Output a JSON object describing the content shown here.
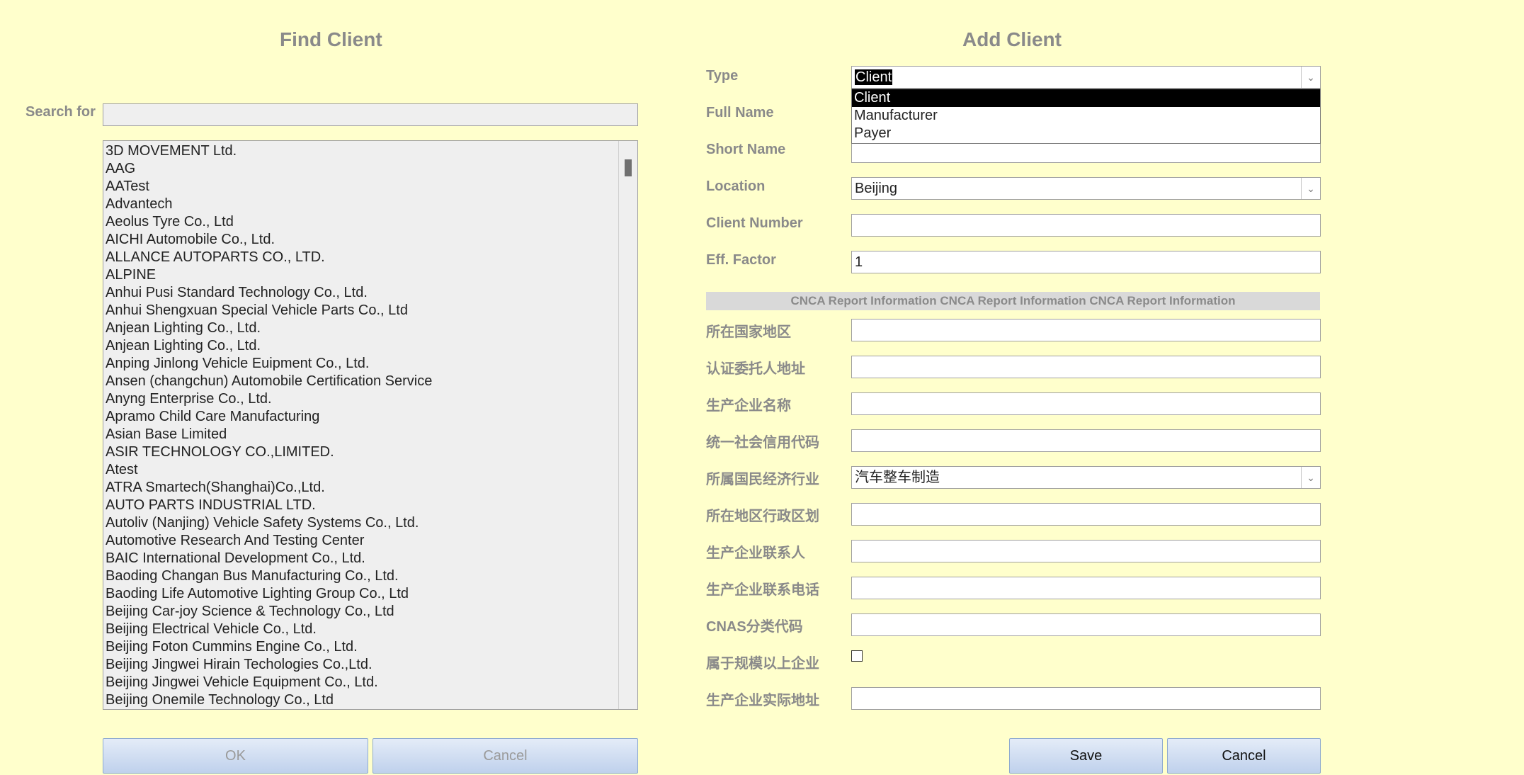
{
  "find": {
    "title": "Find Client",
    "search_label": "Search for",
    "search_value": "",
    "clients": [
      "3D MOVEMENT Ltd.",
      "AAG",
      "AATest",
      "Advantech",
      "Aeolus Tyre Co., Ltd",
      "AICHI Automobile Co., Ltd.",
      "ALLANCE AUTOPARTS CO., LTD.",
      "ALPINE",
      "Anhui Pusi Standard Technology Co., Ltd.",
      "Anhui Shengxuan Special Vehicle Parts Co., Ltd",
      "Anjean Lighting Co., Ltd.",
      "Anjean Lighting Co., Ltd.",
      "Anping Jinlong Vehicle Euipment Co., Ltd.",
      "Ansen (changchun) Automobile Certification Service",
      "Anyng Enterprise Co., Ltd.",
      "Apramo Child Care Manufacturing",
      "Asian Base Limited",
      "ASIR TECHNOLOGY CO.,LIMITED.",
      "Atest",
      "ATRA Smartech(Shanghai)Co.,Ltd.",
      "AUTO PARTS INDUSTRIAL LTD.",
      "Autoliv (Nanjing) Vehicle Safety Systems Co., Ltd.",
      "Automotive Research And Testing Center",
      "BAIC International Development Co., Ltd.",
      "Baoding Changan Bus Manufacturing Co., Ltd.",
      "Baoding Life Automotive Lighting Group Co., Ltd",
      "Beijing Car-joy Science & Technology Co., Ltd",
      "Beijing Electrical Vehicle Co., Ltd.",
      "Beijing Foton Cummins Engine Co., Ltd.",
      "Beijing Jingwei Hirain Techologies Co.,Ltd.",
      "Beijing Jingwei Vehicle Equipment Co., Ltd.",
      "Beijing Onemile Technology Co., Ltd"
    ],
    "ok_label": "OK",
    "cancel_label": "Cancel"
  },
  "add": {
    "title": "Add Client",
    "type_label": "Type",
    "type_value": "Client",
    "type_options": [
      "Client",
      "Manufacturer",
      "Payer"
    ],
    "full_name_label": "Full Name",
    "short_name_label": "Short Name",
    "location_label": "Location",
    "location_value": "Beijing",
    "client_number_label": "Client Number",
    "eff_factor_label": "Eff. Factor",
    "eff_factor_value": "1",
    "section_title": "CNCA Report Information CNCA Report Information CNCA Report Information",
    "country_label": "所在国家地区",
    "applicant_address_label": "认证委托人地址",
    "manufacturer_name_label": "生产企业名称",
    "credit_code_label": "统一社会信用代码",
    "industry_label": "所属国民经济行业",
    "industry_value": "汽车整车制造",
    "admin_division_label": "所在地区行政区划",
    "contact_label": "生产企业联系人",
    "phone_label": "生产企业联系电话",
    "cnas_label": "CNAS分类代码",
    "above_scale_label": "属于规模以上企业",
    "actual_address_label": "生产企业实际地址",
    "save_label": "Save",
    "cancel_label": "Cancel"
  }
}
